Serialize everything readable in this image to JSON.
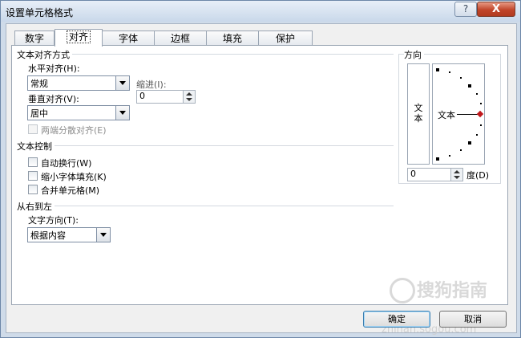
{
  "window": {
    "title": "设置单元格格式",
    "help_glyph": "?",
    "close_glyph": "X"
  },
  "tabs": [
    {
      "label": "数字",
      "active": false
    },
    {
      "label": "对齐",
      "active": true
    },
    {
      "label": "字体",
      "active": false
    },
    {
      "label": "边框",
      "active": false
    },
    {
      "label": "填充",
      "active": false
    },
    {
      "label": "保护",
      "active": false
    }
  ],
  "alignment": {
    "group_label": "文本对齐方式",
    "horizontal_label": "水平对齐(H):",
    "horizontal_value": "常规",
    "indent_label": "缩进(I):",
    "indent_value": "0",
    "vertical_label": "垂直对齐(V):",
    "vertical_value": "居中",
    "justify_distributed_label": "两端分散对齐(E)"
  },
  "text_control": {
    "group_label": "文本控制",
    "wrap_label": "自动换行(W)",
    "shrink_label": "缩小字体填充(K)",
    "merge_label": "合并单元格(M)"
  },
  "rtl": {
    "group_label": "从右到左",
    "direction_label": "文字方向(T):",
    "direction_value": "根据内容"
  },
  "orientation": {
    "group_label": "方向",
    "vertical_text": [
      "文",
      "本"
    ],
    "dial_text": "文本",
    "degree_value": "0",
    "degree_label": "度(D)"
  },
  "buttons": {
    "ok": "确定",
    "cancel": "取消"
  },
  "watermark": {
    "text": "搜狗指南",
    "url": "zhinan.sogou.com"
  }
}
